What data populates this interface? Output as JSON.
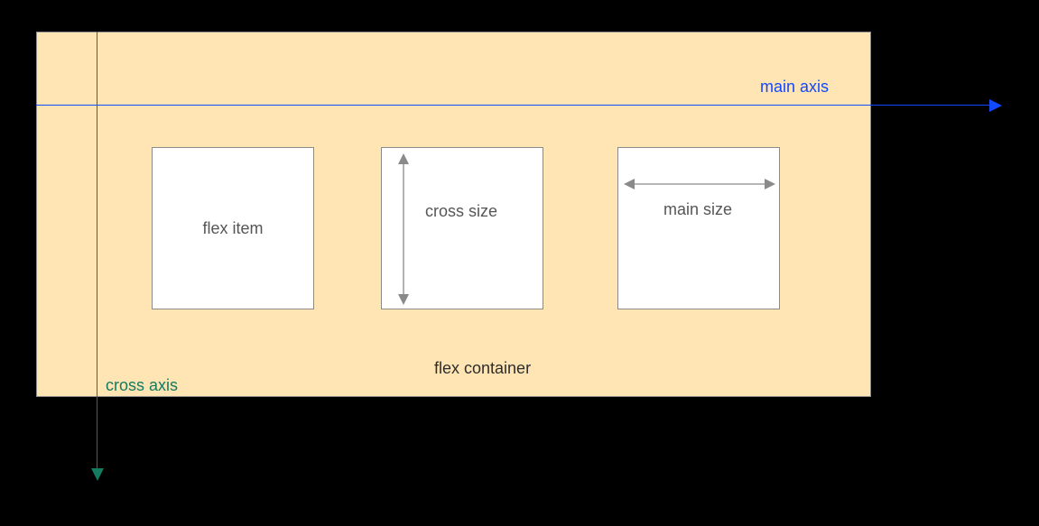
{
  "labels": {
    "main_axis": "main axis",
    "cross_axis": "cross axis",
    "flex_container": "flex container",
    "flex_item": "flex item",
    "cross_size": "cross size",
    "main_size": "main size"
  },
  "colors": {
    "container_bg": "#ffe5b4",
    "item_bg": "#ffffff",
    "border": "#8a8a8a",
    "main_axis": "#1149ff",
    "cross_axis": "#147a60",
    "text_gray": "#565656",
    "text_dark": "#2d2d2d"
  }
}
